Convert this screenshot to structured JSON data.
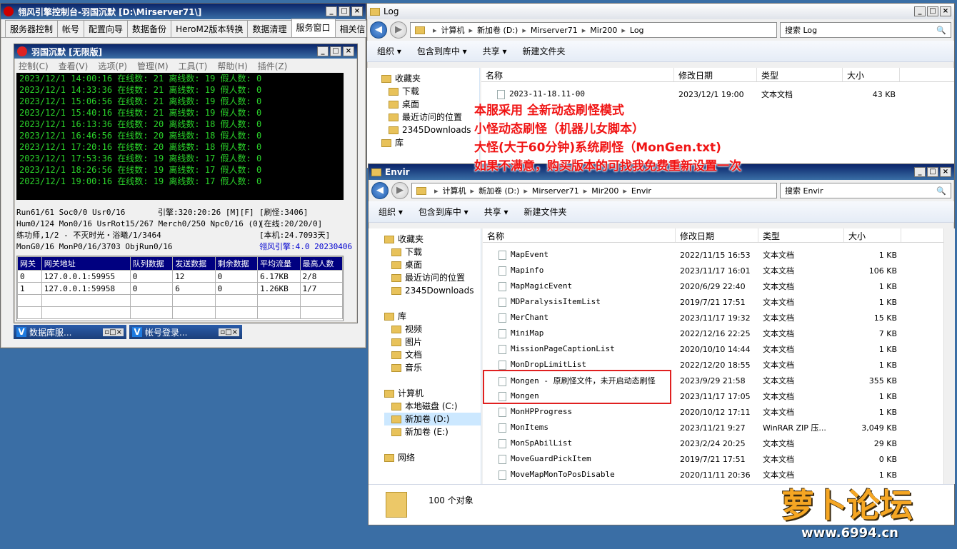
{
  "engine": {
    "title": "翎风引擎控制台-羽国沉默 [D:\\Mirserver71\\]",
    "tabs": [
      "服务器控制",
      "帐号",
      "配置向导",
      "数据备份",
      "HeroM2版本转换",
      "数据清理",
      "服务窗口",
      "相关信"
    ],
    "active_tab": 6,
    "inner_title": "羽国沉默 [无限版]",
    "menu": [
      "控制(C)",
      "查看(V)",
      "选项(P)",
      "管理(M)",
      "工具(T)",
      "帮助(H)",
      "插件(Z)"
    ],
    "log": [
      "2023/12/1 14:00:16 在线数: 21 离线数: 19 假人数: 0",
      "2023/12/1 14:33:36 在线数: 21 离线数: 19 假人数: 0",
      "2023/12/1 15:06:56 在线数: 21 离线数: 19 假人数: 0",
      "2023/12/1 15:40:16 在线数: 21 离线数: 19 假人数: 0",
      "2023/12/1 16:13:36 在线数: 20 离线数: 18 假人数: 0",
      "2023/12/1 16:46:56 在线数: 20 离线数: 18 假人数: 0",
      "2023/12/1 17:20:16 在线数: 20 离线数: 18 假人数: 0",
      "2023/12/1 17:53:36 在线数: 19 离线数: 17 假人数: 0",
      "2023/12/1 18:26:56 在线数: 19 离线数: 17 假人数: 0",
      "2023/12/1 19:00:16 在线数: 19 离线数: 17 假人数: 0"
    ],
    "status": {
      "l1a": "Run61/61 Soc0/0 Usr0/16",
      "l1b": "引擎:320:20:26 [M][F]",
      "l1c": "[刷怪:3406]",
      "l2a": "Hum0/124 Mon0/16 UsrRot15/267 Merch0/250 Npc0/16 (0)",
      "l2c": "[在线:20/20/0]",
      "l3a": "练功师,1/2 - 不灭时光・浴曦/1/3464",
      "l3c": "[本机:24.7093天]",
      "l4a": "MonG0/16 MonP0/16/3703 ObjRun0/16",
      "l4c": "翎风引擎:4.0 20230406"
    },
    "table_headers": [
      "网关",
      "网关地址",
      "队列数据",
      "发送数据",
      "剩余数据",
      "平均流量",
      "最高人数"
    ],
    "table_rows": [
      [
        "0",
        "127.0.0.1:59955",
        "0",
        "12",
        "0",
        "6.17KB",
        "2/8"
      ],
      [
        "1",
        "127.0.0.1:59958",
        "0",
        "6",
        "0",
        "1.26KB",
        "1/7"
      ]
    ],
    "taskbar": [
      "数据库服...",
      "帐号登录..."
    ]
  },
  "log_window": {
    "title": "Log",
    "path": [
      "计算机",
      "新加卷 (D:)",
      "Mirserver71",
      "Mir200",
      "Log"
    ],
    "search": "搜索 Log",
    "toolbar": [
      "组织 ▾",
      "包含到库中 ▾",
      "共享 ▾",
      "新建文件夹"
    ],
    "nav": [
      "收藏夹",
      "下载",
      "桌面",
      "最近访问的位置",
      "2345Downloads",
      "库"
    ],
    "columns": [
      "名称",
      "修改日期",
      "类型",
      "大小"
    ],
    "files": [
      [
        "2023-11-18.11-00",
        "2023/12/1 19:00",
        "文本文档",
        "43 KB"
      ]
    ]
  },
  "envir_window": {
    "title": "Envir",
    "path": [
      "计算机",
      "新加卷 (D:)",
      "Mirserver71",
      "Mir200",
      "Envir"
    ],
    "search": "搜索 Envir",
    "toolbar": [
      "组织 ▾",
      "包含到库中 ▾",
      "共享 ▾",
      "新建文件夹"
    ],
    "nav": [
      "收藏夹",
      "下载",
      "桌面",
      "最近访问的位置",
      "2345Downloads",
      "",
      "库",
      "视频",
      "图片",
      "文档",
      "音乐",
      "",
      "计算机",
      "本地磁盘 (C:)",
      "新加卷 (D:)",
      "新加卷 (E:)",
      "",
      "网络"
    ],
    "columns": [
      "名称",
      "修改日期",
      "类型",
      "大小"
    ],
    "files": [
      [
        "MapEvent",
        "2022/11/15 16:53",
        "文本文档",
        "1 KB"
      ],
      [
        "Mapinfo",
        "2023/11/17 16:01",
        "文本文档",
        "106 KB"
      ],
      [
        "MapMagicEvent",
        "2020/6/29 22:40",
        "文本文档",
        "1 KB"
      ],
      [
        "MDParalysisItemList",
        "2019/7/21 17:51",
        "文本文档",
        "1 KB"
      ],
      [
        "MerChant",
        "2023/11/17 19:32",
        "文本文档",
        "15 KB"
      ],
      [
        "MiniMap",
        "2022/12/16 22:25",
        "文本文档",
        "7 KB"
      ],
      [
        "MissionPageCaptionList",
        "2020/10/10 14:44",
        "文本文档",
        "1 KB"
      ],
      [
        "MonDropLimitList",
        "2022/12/20 18:55",
        "文本文档",
        "1 KB"
      ],
      [
        "Mongen - 原刷怪文件，未开启动态刷怪",
        "2023/9/29 21:58",
        "文本文档",
        "355 KB"
      ],
      [
        "Mongen",
        "2023/11/17 17:05",
        "文本文档",
        "1 KB"
      ],
      [
        "MonHPProgress",
        "2020/10/12 17:11",
        "文本文档",
        "1 KB"
      ],
      [
        "MonItems",
        "2023/11/21 9:27",
        "WinRAR ZIP 压...",
        "3,049 KB"
      ],
      [
        "MonSpAbilList",
        "2023/2/24 20:25",
        "文本文档",
        "29 KB"
      ],
      [
        "MoveGuardPickItem",
        "2019/7/21 17:51",
        "文本文档",
        "0 KB"
      ],
      [
        "MoveMapMonToPosDisable",
        "2020/11/11 20:36",
        "文本文档",
        "1 KB"
      ]
    ],
    "count": "100 个对象"
  },
  "overlay": [
    "本服采用 全新动态刷怪模式",
    "小怪动态刷怪（机器儿女脚本）",
    "大怪(大于60分钟)系统刷怪（MonGen.txt)",
    "如果不满意，购买版本的可找我免费重新设置一次"
  ],
  "watermark": {
    "name": "萝卜论坛",
    "url": "www.6994.cn"
  }
}
